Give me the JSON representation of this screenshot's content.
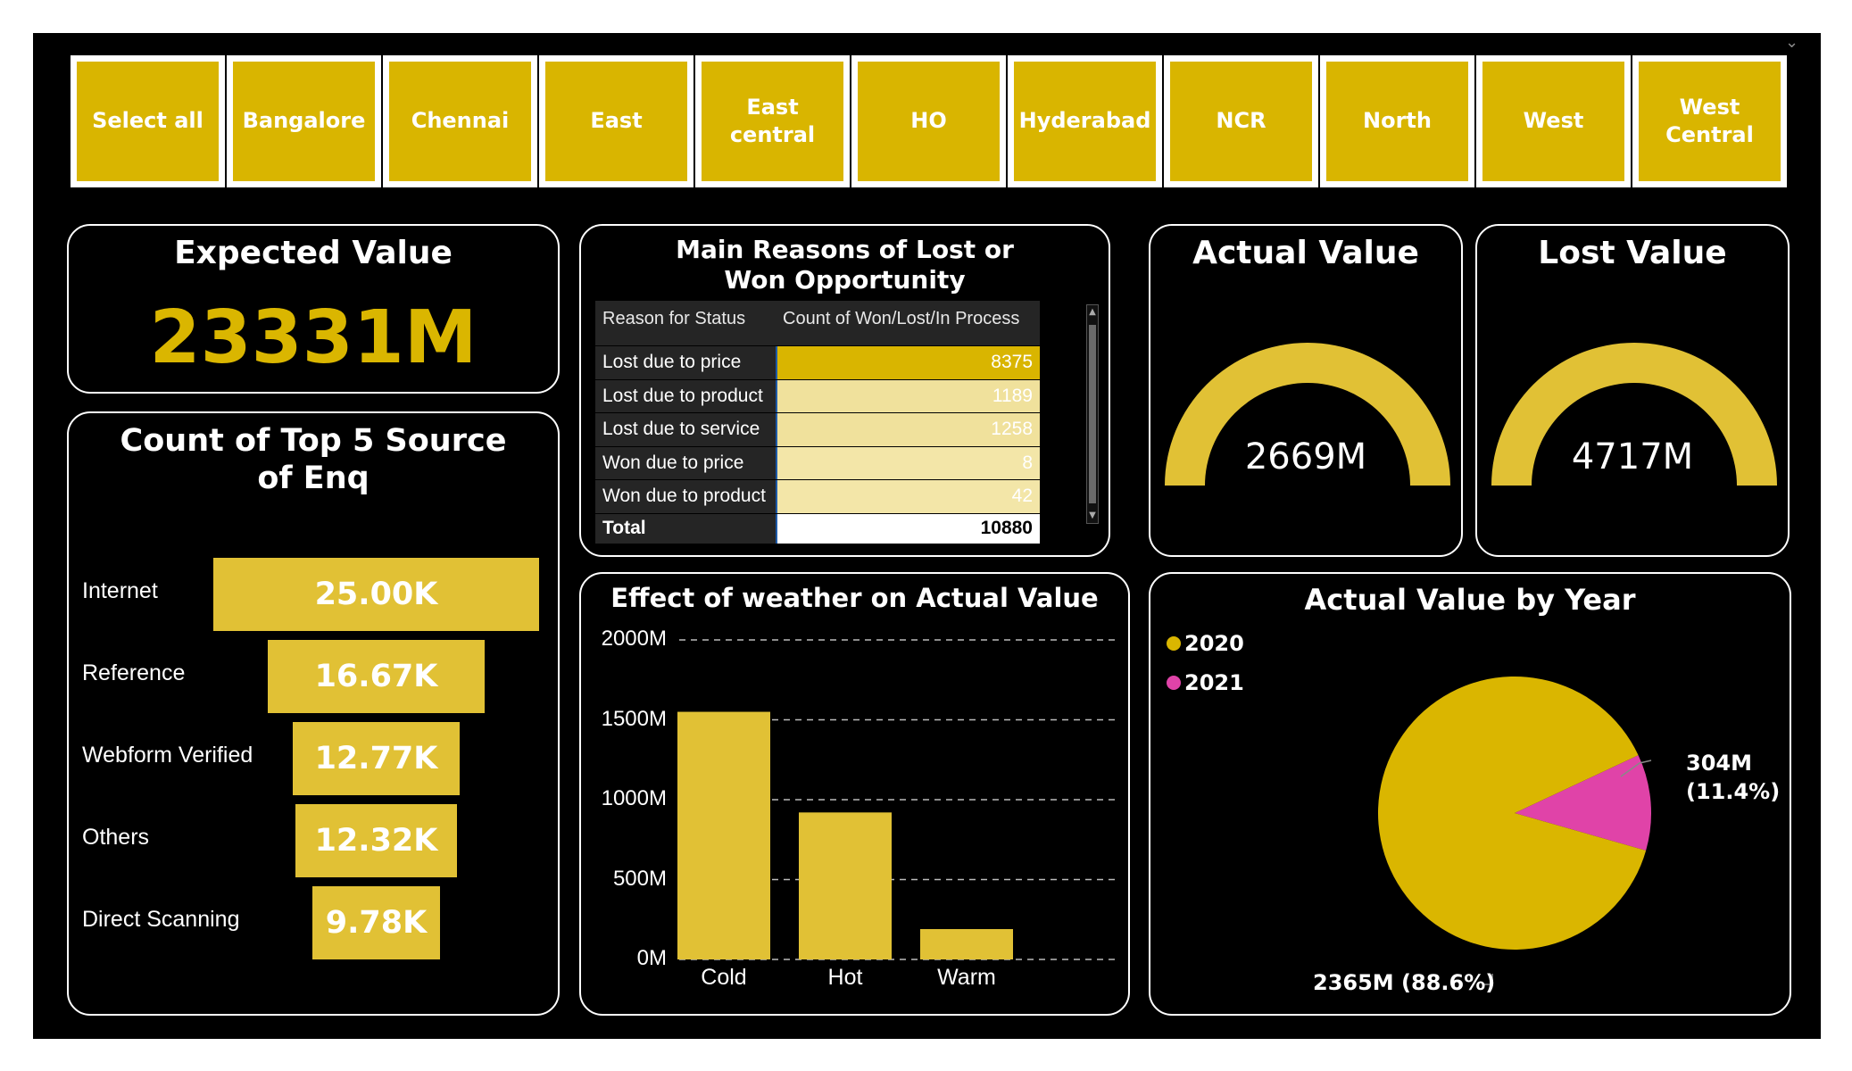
{
  "slicer": {
    "items": [
      "Select all",
      "Bangalore",
      "Chennai",
      "East",
      "East central",
      "HO",
      "Hyderabad",
      "NCR",
      "North",
      "West",
      "West Central"
    ]
  },
  "expected_value": {
    "title": "Expected Value",
    "value": "23331M"
  },
  "funnel": {
    "title": "Count of Top 5 Source of Enq",
    "items": [
      {
        "label": "Internet",
        "value": "25.00K",
        "count": 25000
      },
      {
        "label": "Reference",
        "value": "16.67K",
        "count": 16670
      },
      {
        "label": "Webform Verified",
        "value": "12.77K",
        "count": 12770
      },
      {
        "label": "Others",
        "value": "12.32K",
        "count": 12320
      },
      {
        "label": "Direct Scanning",
        "value": "9.78K",
        "count": 9780
      }
    ]
  },
  "reasons_table": {
    "title": "Main Reasons of Lost or Won Opportunity",
    "headers": [
      "Reason for Status",
      "Count of Won/Lost/In Process"
    ],
    "rows": [
      {
        "reason": "Lost due to price",
        "count": "8375"
      },
      {
        "reason": "Lost due to product",
        "count": "1189"
      },
      {
        "reason": "Lost due to service",
        "count": "1258"
      },
      {
        "reason": "Won due to price",
        "count": "8"
      },
      {
        "reason": "Won due to product",
        "count": "42"
      }
    ],
    "total_label": "Total",
    "total_value": "10880"
  },
  "actual_value": {
    "title": "Actual Value",
    "value": "2669M"
  },
  "lost_value": {
    "title": "Lost Value",
    "value": "4717M"
  },
  "weather_chart": {
    "title": "Effect of weather on Actual Value"
  },
  "year_chart": {
    "title": "Actual Value by Year",
    "legend": [
      "2020",
      "2021"
    ],
    "label_2021_line1": "304M",
    "label_2021_line2": "(11.4%)",
    "label_2020": "2365M (88.6%)"
  },
  "colors": {
    "gold": "#dab600",
    "bar": "#e1c135",
    "pink": "#e043a8",
    "background": "#000000"
  },
  "chart_data": [
    {
      "type": "bar",
      "title": "Effect of weather on Actual Value",
      "categories": [
        "Cold",
        "Hot",
        "Warm"
      ],
      "values": [
        1550,
        920,
        190
      ],
      "unit": "M",
      "ylim": [
        0,
        2000
      ],
      "yticks": [
        "0M",
        "500M",
        "1000M",
        "1500M",
        "2000M"
      ],
      "grid": true
    },
    {
      "type": "pie",
      "title": "Actual Value by Year",
      "categories": [
        "2020",
        "2021"
      ],
      "values": [
        2365,
        304
      ],
      "percent": [
        88.6,
        11.4
      ],
      "legend": "top-left"
    }
  ]
}
